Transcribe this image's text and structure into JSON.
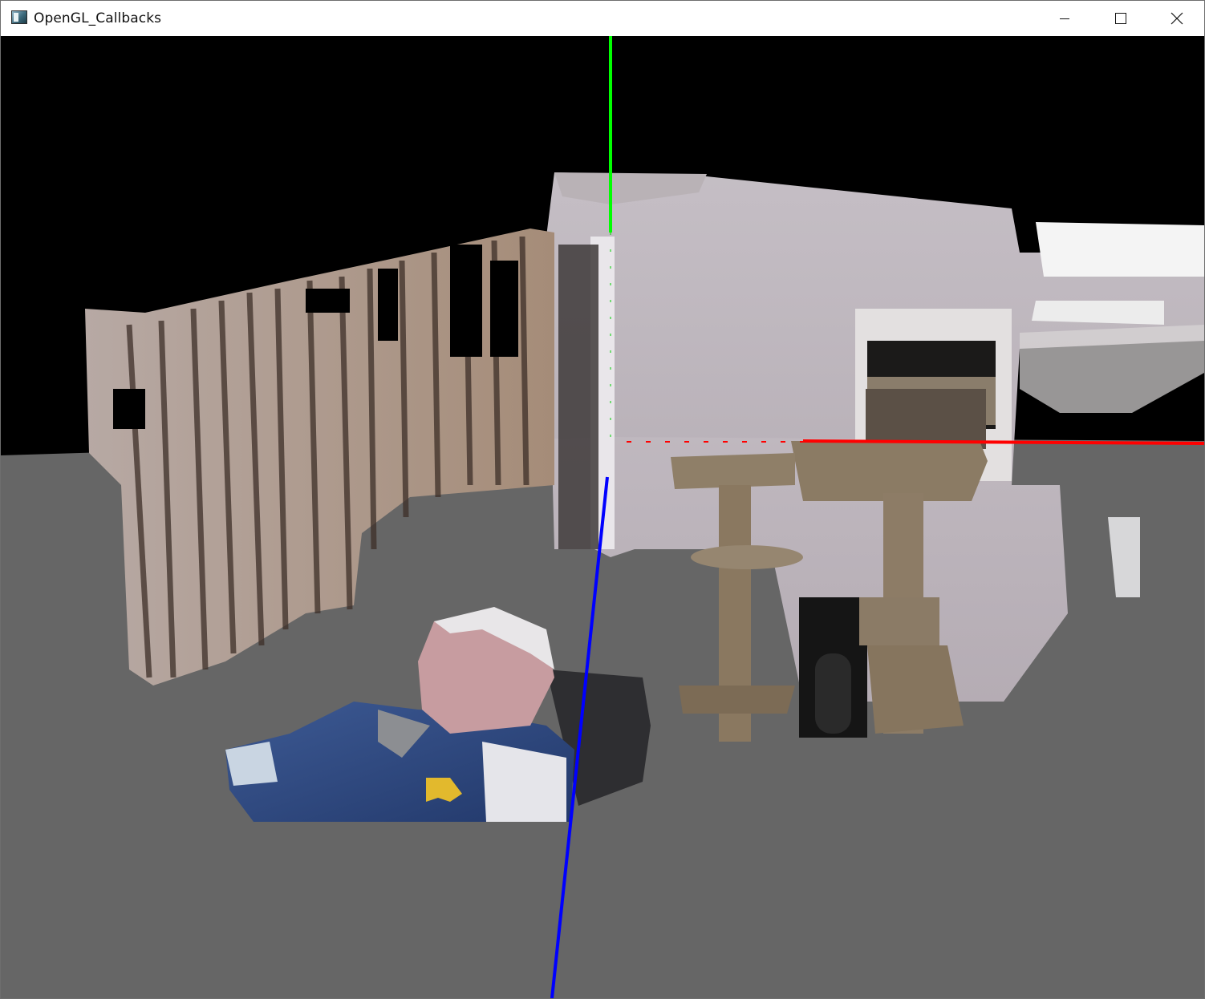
{
  "window": {
    "title": "OpenGL_Callbacks",
    "icon": "opengl-app-icon",
    "controls": {
      "minimize": "minimize-icon",
      "maximize": "maximize-icon",
      "close": "close-icon"
    }
  },
  "scene": {
    "background_color": "#000000",
    "ground_color": "#666666",
    "axes": {
      "x_color": "#ff0000",
      "y_color": "#00ff00",
      "z_color": "#0000ff"
    },
    "content": "3d-point-cloud-render"
  }
}
